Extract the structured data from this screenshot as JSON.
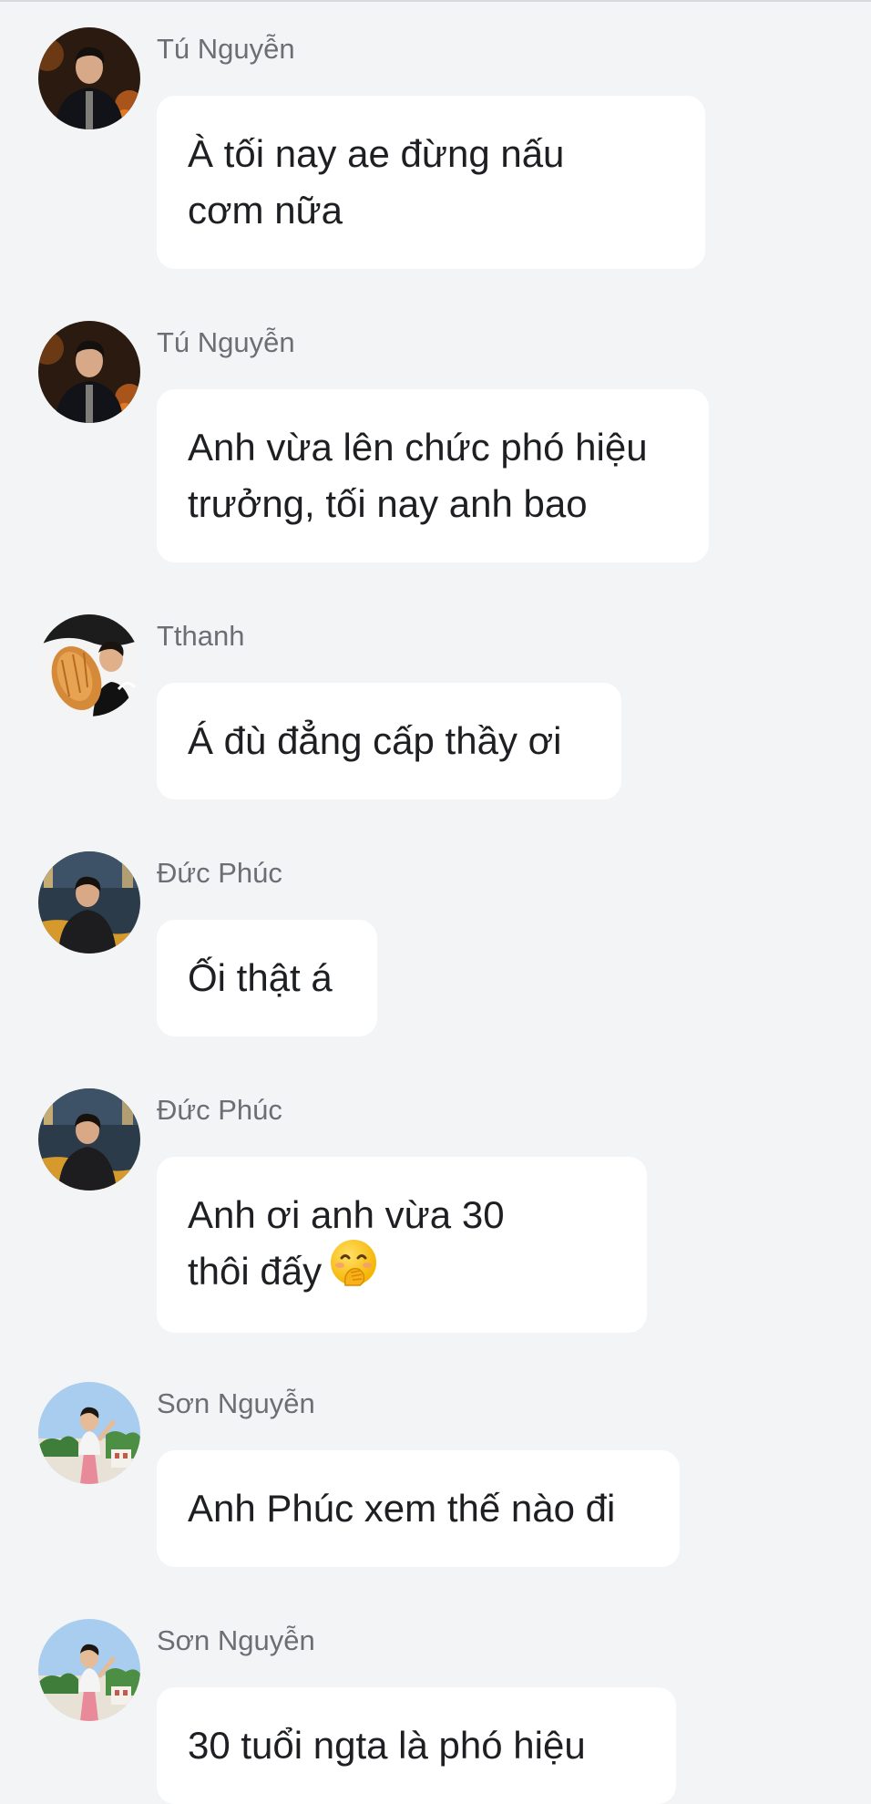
{
  "messages": [
    {
      "sender": "Tú Nguyễn",
      "avatar_icon": "avatar-tu-nguyen",
      "lines": [
        "À tối nay ae đừng nấu",
        "cơm nữa"
      ]
    },
    {
      "sender": "Tú Nguyễn",
      "avatar_icon": "avatar-tu-nguyen",
      "lines": [
        "Anh vừa lên chức phó hiệu",
        "trưởng, tối nay anh bao"
      ]
    },
    {
      "sender": "Tthanh",
      "avatar_icon": "avatar-tthanh",
      "lines": [
        "Á đù đẳng cấp thầy ơi"
      ]
    },
    {
      "sender": "Đức Phúc",
      "avatar_icon": "avatar-duc-phuc",
      "lines": [
        "Ối thật á"
      ]
    },
    {
      "sender": "Đức Phúc",
      "avatar_icon": "avatar-duc-phuc",
      "lines": [
        "Anh ơi anh vừa 30",
        "thôi đấy"
      ],
      "emoji": "face-with-hand-over-mouth-emoji"
    },
    {
      "sender": "Sơn Nguyễn",
      "avatar_icon": "avatar-son-nguyen",
      "lines": [
        "Anh Phúc xem thế nào đi"
      ]
    },
    {
      "sender": "Sơn Nguyễn",
      "avatar_icon": "avatar-son-nguyen",
      "lines": [
        "30 tuổi ngta là phó hiệu"
      ]
    }
  ]
}
